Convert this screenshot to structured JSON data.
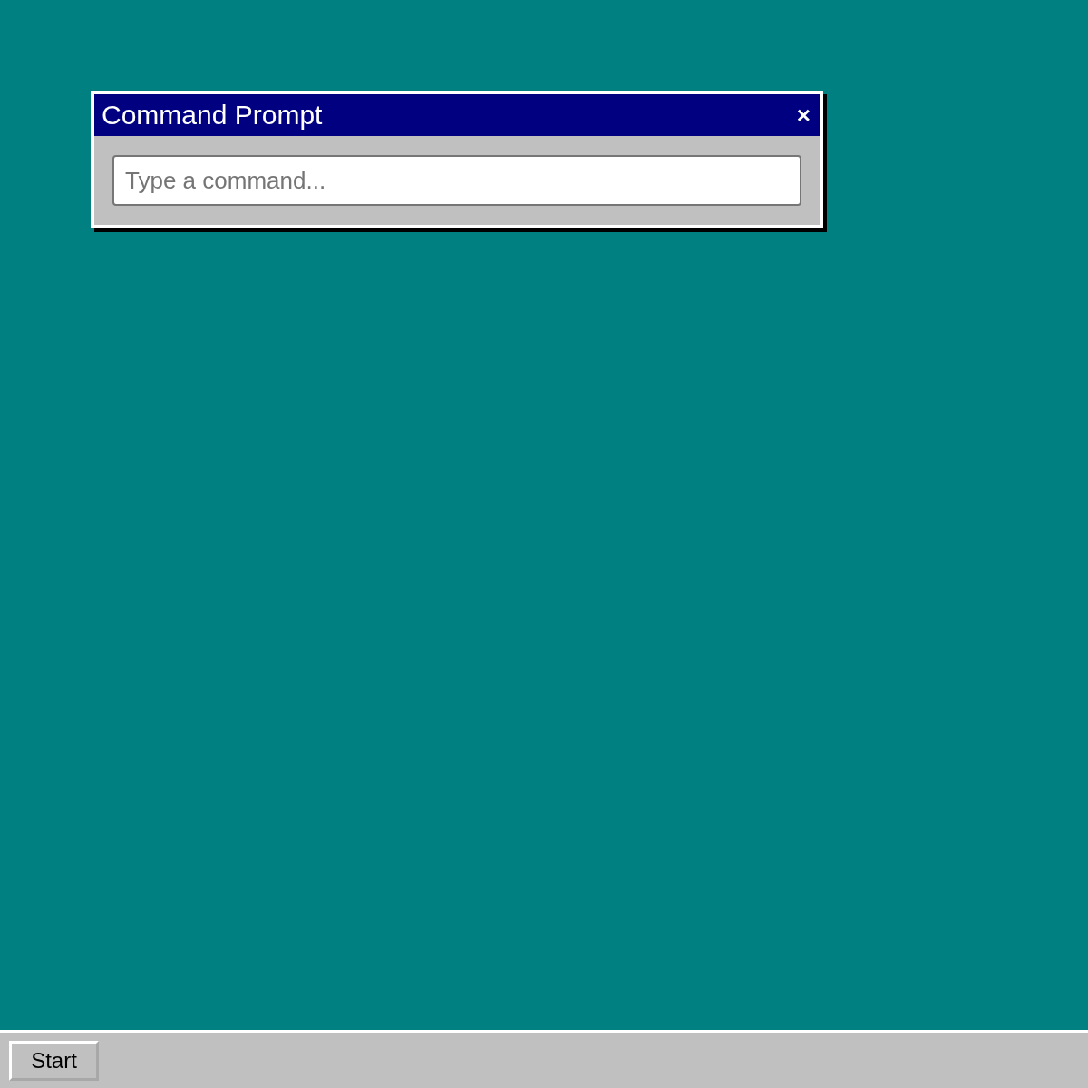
{
  "window": {
    "title": "Command Prompt",
    "close": "×"
  },
  "command_field": {
    "placeholder": "Type a command..."
  },
  "taskbar": {
    "start_button": "Start"
  }
}
